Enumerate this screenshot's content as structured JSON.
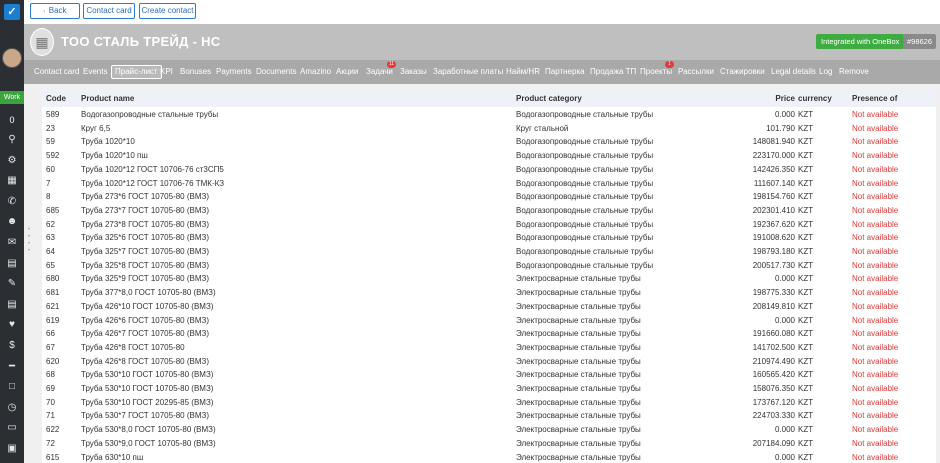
{
  "sidebar": {
    "work_label": "Work",
    "counter": "0",
    "icons": [
      "search-icon",
      "gear-icon",
      "calendar-icon",
      "phone-icon",
      "user-icon",
      "mail-icon",
      "card-icon",
      "pen-icon",
      "document-icon",
      "basket-icon",
      "dollar-icon",
      "gun-icon",
      "clipboard-icon",
      "clock-icon",
      "car-icon",
      "box-icon"
    ]
  },
  "topbar": {
    "back": "Back",
    "contact_card": "Contact card",
    "create_contact": "Create contact"
  },
  "header": {
    "company_name": "ТОО СТАЛЬ ТРЕЙД - НС",
    "integration": "Integrated with OneBox",
    "record_id": "#98626"
  },
  "tabs": [
    {
      "label": "Contact card",
      "badge": ""
    },
    {
      "label": "Events",
      "badge": ""
    },
    {
      "label": "Прайс-лист",
      "badge": "",
      "active": true
    },
    {
      "label": "KPI",
      "badge": ""
    },
    {
      "label": "Bonuses",
      "badge": ""
    },
    {
      "label": "Payments",
      "badge": ""
    },
    {
      "label": "Documents",
      "badge": ""
    },
    {
      "label": "Amazino",
      "badge": ""
    },
    {
      "label": "Акции",
      "badge": ""
    },
    {
      "label": "Задачи",
      "badge": "11"
    },
    {
      "label": "Заказы",
      "badge": ""
    },
    {
      "label": "Заработные платы",
      "badge": ""
    },
    {
      "label": "Найм/HR",
      "badge": ""
    },
    {
      "label": "Партнерка",
      "badge": ""
    },
    {
      "label": "Продажа ТП",
      "badge": ""
    },
    {
      "label": "Проекты",
      "badge": "1"
    },
    {
      "label": "Рассылки",
      "badge": ""
    },
    {
      "label": "Стажировки",
      "badge": ""
    },
    {
      "label": "Legal details",
      "badge": ""
    },
    {
      "label": "Log",
      "badge": ""
    },
    {
      "label": "Remove",
      "badge": ""
    }
  ],
  "table": {
    "columns": [
      "Code",
      "Product name",
      "Product category",
      "Price",
      "currency",
      "Presence of"
    ],
    "rows": [
      [
        "589",
        "Водогазопроводные стальные трубы",
        "Водогазопроводные стальные трубы",
        "0.000",
        "KZT",
        "Not available"
      ],
      [
        "23",
        "Круг 6,5",
        "Круг стальной",
        "101.790",
        "KZT",
        "Not available"
      ],
      [
        "59",
        "Труба 1020*10",
        "Водогазопроводные стальные трубы",
        "148081.940",
        "KZT",
        "Not available"
      ],
      [
        "592",
        "Труба 1020*10 пш",
        "Водогазопроводные стальные трубы",
        "223170.000",
        "KZT",
        "Not available"
      ],
      [
        "60",
        "Труба 1020*12 ГОСТ 10706-76 ст3СП5",
        "Водогазопроводные стальные трубы",
        "142426.350",
        "KZT",
        "Not available"
      ],
      [
        "7",
        "Труба 1020*12 ГОСТ 10706-76 ТМК-КЗ",
        "Водогазопроводные стальные трубы",
        "111607.140",
        "KZT",
        "Not available"
      ],
      [
        "8",
        "Труба 273*6 ГОСТ 10705-80 (ВМЗ)",
        "Водогазопроводные стальные трубы",
        "198154.760",
        "KZT",
        "Not available"
      ],
      [
        "685",
        "Труба 273*7 ГОСТ 10705-80 (ВМЗ)",
        "Водогазопроводные стальные трубы",
        "202301.410",
        "KZT",
        "Not available"
      ],
      [
        "62",
        "Труба 273*8 ГОСТ 10705-80 (ВМЗ)",
        "Водогазопроводные стальные трубы",
        "192367.620",
        "KZT",
        "Not available"
      ],
      [
        "63",
        "Труба 325*6 ГОСТ 10705-80 (ВМЗ)",
        "Водогазопроводные стальные трубы",
        "191008.620",
        "KZT",
        "Not available"
      ],
      [
        "64",
        "Труба 325*7 ГОСТ 10705-80 (ВМЗ)",
        "Водогазопроводные стальные трубы",
        "198793.180",
        "KZT",
        "Not available"
      ],
      [
        "65",
        "Труба 325*8 ГОСТ 10705-80 (ВМЗ)",
        "Водогазопроводные стальные трубы",
        "200517.730",
        "KZT",
        "Not available"
      ],
      [
        "680",
        "Труба 325*9 ГОСТ 10705-80 (ВМЗ)",
        "Электросварные стальные трубы",
        "0.000",
        "KZT",
        "Not available"
      ],
      [
        "681",
        "Труба 377*8,0 ГОСТ 10705-80 (ВМЗ)",
        "Электросварные стальные трубы",
        "198775.330",
        "KZT",
        "Not available"
      ],
      [
        "621",
        "Труба 426*10 ГОСТ 10705-80 (ВМЗ)",
        "Электросварные стальные трубы",
        "208149.810",
        "KZT",
        "Not available"
      ],
      [
        "619",
        "Труба 426*6 ГОСТ 10705-80 (ВМЗ)",
        "Электросварные стальные трубы",
        "0.000",
        "KZT",
        "Not available"
      ],
      [
        "66",
        "Труба 426*7 ГОСТ 10705-80 (ВМЗ)",
        "Электросварные стальные трубы",
        "191660.080",
        "KZT",
        "Not available"
      ],
      [
        "67",
        "Труба 426*8 ГОСТ 10705-80",
        "Электросварные стальные трубы",
        "141702.500",
        "KZT",
        "Not available"
      ],
      [
        "620",
        "Труба 426*8 ГОСТ 10705-80 (ВМЗ)",
        "Электросварные стальные трубы",
        "210974.490",
        "KZT",
        "Not available"
      ],
      [
        "68",
        "Труба 530*10 ГОСТ 10705-80 (ВМЗ)",
        "Электросварные стальные трубы",
        "160565.420",
        "KZT",
        "Not available"
      ],
      [
        "69",
        "Труба 530*10 ГОСТ 10705-80 (ВМЗ)",
        "Электросварные стальные трубы",
        "158076.350",
        "KZT",
        "Not available"
      ],
      [
        "70",
        "Труба 530*10 ГОСТ 20295-85 (ВМЗ)",
        "Электросварные стальные трубы",
        "173767.120",
        "KZT",
        "Not available"
      ],
      [
        "71",
        "Труба 530*7 ГОСТ 10705-80 (ВМЗ)",
        "Электросварные стальные трубы",
        "224703.330",
        "KZT",
        "Not available"
      ],
      [
        "622",
        "Труба 530*8,0 ГОСТ 10705-80 (ВМЗ)",
        "Электросварные стальные трубы",
        "0.000",
        "KZT",
        "Not available"
      ],
      [
        "72",
        "Труба 530*9,0 ГОСТ 10705-80 (ВМЗ)",
        "Электросварные стальные трубы",
        "207184.090",
        "KZT",
        "Not available"
      ],
      [
        "615",
        "Труба 630*10 пш",
        "Электросварные стальные трубы",
        "0.000",
        "KZT",
        "Not available"
      ]
    ]
  },
  "colors": {
    "accent": "#2c7bd1",
    "work_green": "#3aa53a",
    "not_available_red": "#e03a3a"
  }
}
